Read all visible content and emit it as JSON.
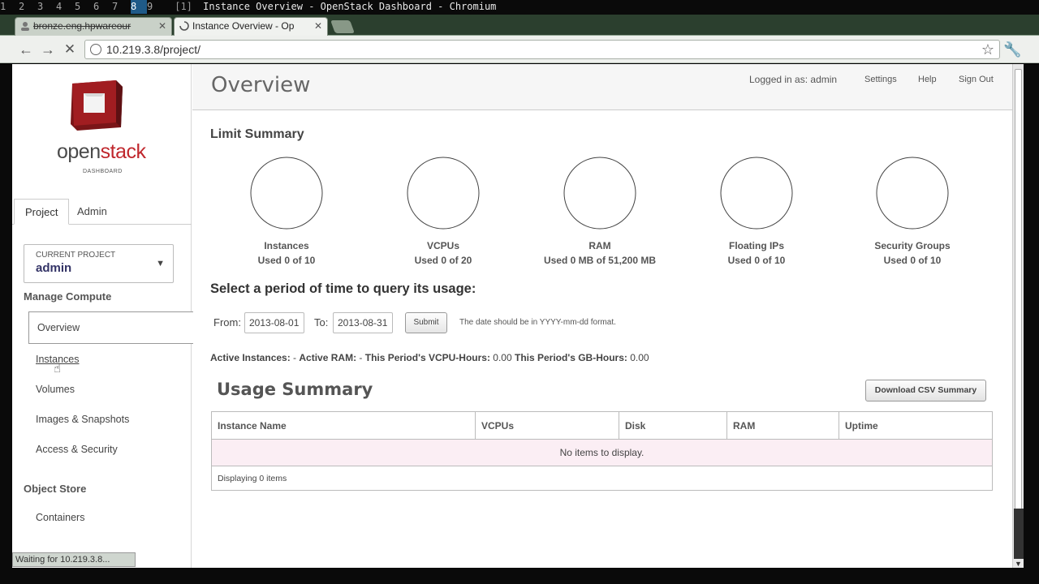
{
  "wm": {
    "workspaces": [
      "1",
      "2",
      "3",
      "4",
      "5",
      "6",
      "7",
      "8",
      "9"
    ],
    "active_workspace": "8",
    "layout": "[1]",
    "window_title": "Instance Overview - OpenStack Dashboard - Chromium"
  },
  "browser": {
    "tabs": [
      {
        "label": "bronze.eng.hpwareour"
      },
      {
        "label": "Instance Overview - Op"
      }
    ],
    "url": "10.219.3.8/project/"
  },
  "status_bar": "Waiting for 10.219.3.8...",
  "sidebar": {
    "logo_brand_open": "open",
    "logo_brand_stack": "stack",
    "logo_sub": "DASHBOARD",
    "tabs": [
      "Project",
      "Admin"
    ],
    "current_project_caption": "CURRENT PROJECT",
    "current_project": "admin",
    "sections": [
      {
        "title": "Manage Compute",
        "items": [
          "Overview",
          "Instances",
          "Volumes",
          "Images & Snapshots",
          "Access & Security"
        ]
      },
      {
        "title": "Object Store",
        "items": [
          "Containers"
        ]
      }
    ]
  },
  "header": {
    "title": "Overview",
    "logged_in": "Logged in as: admin",
    "settings": "Settings",
    "help": "Help",
    "sign_out": "Sign Out"
  },
  "limits": {
    "title": "Limit Summary",
    "items": [
      {
        "name": "Instances",
        "used": "Used 0 of 10",
        "fraction": 0
      },
      {
        "name": "VCPUs",
        "used": "Used 0 of 20",
        "fraction": 0
      },
      {
        "name": "RAM",
        "used": "Used 0 MB of 51,200 MB",
        "fraction": 0
      },
      {
        "name": "Floating IPs",
        "used": "Used 0 of 10",
        "fraction": 0
      },
      {
        "name": "Security Groups",
        "used": "Used 0 of 10",
        "fraction": 0
      }
    ]
  },
  "period": {
    "title": "Select a period of time to query its usage:",
    "from_label": "From:",
    "from_value": "2013-08-01",
    "to_label": "To:",
    "to_value": "2013-08-31",
    "submit": "Submit",
    "hint": "The date should be in YYYY-mm-dd format."
  },
  "active_summary": {
    "instances_label": "Active Instances:",
    "instances_value": " - ",
    "ram_label": "Active RAM:",
    "ram_value": " - ",
    "vcpu_label": "This Period's VCPU-Hours:",
    "vcpu_value": " 0.00 ",
    "gb_label": "This Period's GB-Hours:",
    "gb_value": " 0.00"
  },
  "usage": {
    "title": "Usage Summary",
    "csv_button": "Download CSV Summary",
    "columns": [
      "Instance Name",
      "VCPUs",
      "Disk",
      "RAM",
      "Uptime"
    ],
    "empty": "No items to display.",
    "footer": "Displaying 0 items"
  }
}
